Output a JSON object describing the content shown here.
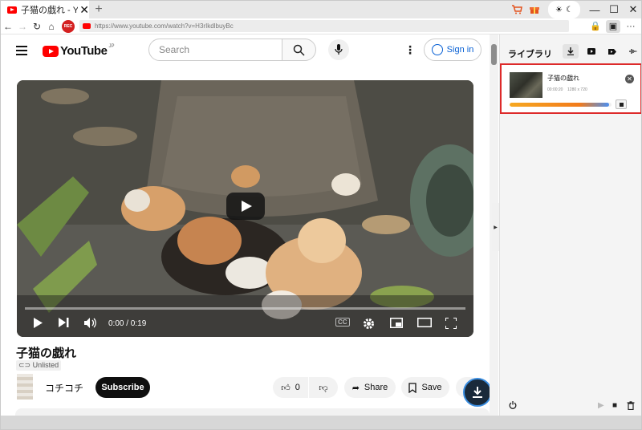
{
  "browser": {
    "tab_title": "子猫の戯れ - YouTube",
    "tab_close": "✕",
    "new_tab": "+",
    "url": "https://www.youtube.com/watch?v=H3rIkdlbuyBc",
    "rec_label": "REC",
    "theme_sun": "☀",
    "theme_moon": "☾",
    "minimize": "—",
    "maximize": "☐",
    "close": "✕",
    "menu": "···"
  },
  "youtube": {
    "logo_text": "YouTube",
    "region": "JP",
    "search_placeholder": "Search",
    "sign_in": "Sign in",
    "video_time": "0:00 / 0:19",
    "video_title": "子猫の戯れ",
    "unlisted": "Unlisted",
    "channel_name": "コチコチ",
    "subscribe": "Subscribe",
    "like_count": "0",
    "share": "Share",
    "save": "Save",
    "cc": "CC"
  },
  "panel": {
    "library_title": "ライブラリ",
    "item": {
      "title": "子猫の戯れ",
      "duration": "00:00:20",
      "resolution": "1280 x 720",
      "progress": 0.98
    }
  },
  "colors": {
    "yt_red": "#ff0000",
    "highlight_border": "#dd2a2a",
    "progress_orange": "#f27b1b",
    "progress_blue": "#4a8ef0",
    "link_blue": "#065fd4"
  }
}
